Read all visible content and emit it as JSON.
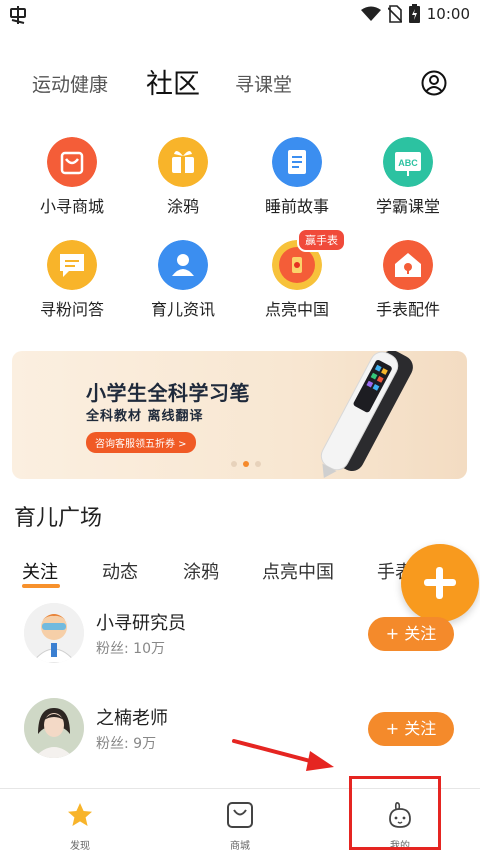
{
  "status_bar": {
    "time": "10:00"
  },
  "top_tabs": [
    {
      "label": "运动健康"
    },
    {
      "label": "社区"
    },
    {
      "label": "寻课堂"
    }
  ],
  "grid": [
    {
      "label": "小寻商城",
      "icon": "shop-bag-icon",
      "color": "#f45d38"
    },
    {
      "label": "涂鸦",
      "icon": "gift-icon",
      "color": "#f8b42a"
    },
    {
      "label": "睡前故事",
      "icon": "book-icon",
      "color": "#3b8ef0"
    },
    {
      "label": "学霸课堂",
      "icon": "abc-board-icon",
      "color": "#2cc2a1"
    },
    {
      "label": "寻粉问答",
      "icon": "chat-bubble-icon",
      "color": "#f8b42a"
    },
    {
      "label": "育儿资讯",
      "icon": "person-card-icon",
      "color": "#3b8ef0"
    },
    {
      "label": "点亮中国",
      "icon": "lantern-icon",
      "color": "#f45d38",
      "badge": "赢手表"
    },
    {
      "label": "手表配件",
      "icon": "house-lock-icon",
      "color": "#f45d38"
    }
  ],
  "banner": {
    "title": "小学生全科学习笔",
    "subtitle": "全科教材 离线翻译",
    "button": "咨询客服领五折券 >"
  },
  "section_title": "育儿广场",
  "sub_tabs": [
    {
      "label": "关注"
    },
    {
      "label": "动态"
    },
    {
      "label": "涂鸦"
    },
    {
      "label": "点亮中国"
    },
    {
      "label": "手表"
    }
  ],
  "users": [
    {
      "name": "小寻研究员",
      "fans": "粉丝: 10万",
      "follow": "+ 关注"
    },
    {
      "name": "之楠老师",
      "fans": "粉丝: 9万",
      "follow": "+ 关注"
    }
  ],
  "bottom_nav": [
    {
      "label": "发现",
      "icon": "star-icon"
    },
    {
      "label": "商城",
      "icon": "bag-icon"
    },
    {
      "label": "我的",
      "icon": "bunny-face-icon"
    }
  ],
  "colors": {
    "accent": "#f48a2b",
    "highlight_box": "#e52521"
  }
}
